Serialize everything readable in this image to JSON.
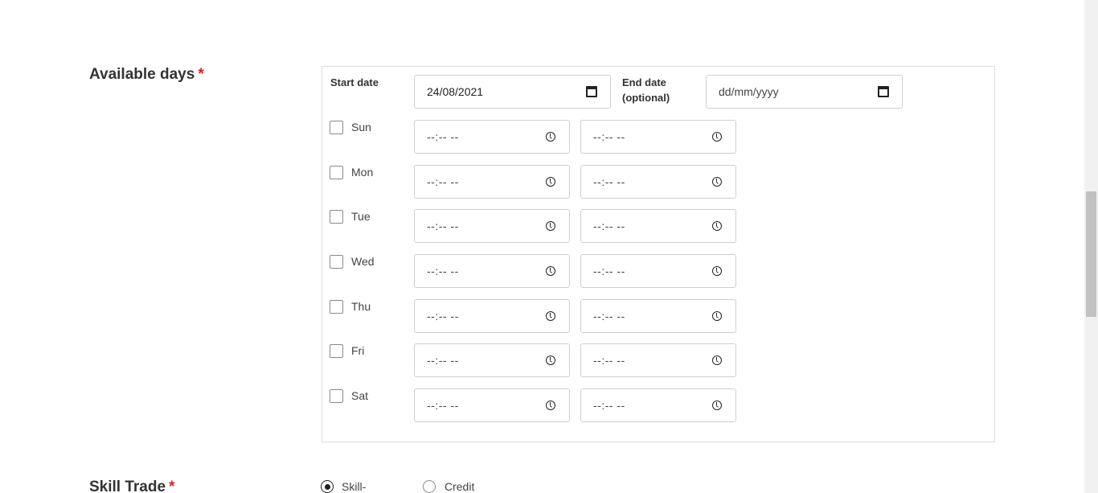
{
  "faded_text": "",
  "available_days": {
    "title": "Available days",
    "required_mark": "*",
    "start_date": {
      "label": "Start date",
      "value": "24/08/2021"
    },
    "end_date": {
      "label_line1": "End date",
      "label_line2": "(optional)",
      "placeholder": "dd/mm/yyyy"
    },
    "time_placeholder": "--:-- --",
    "days": [
      "Sun",
      "Mon",
      "Tue",
      "Wed",
      "Thu",
      "Fri",
      "Sat"
    ]
  },
  "skill_trade": {
    "title": "Skill Trade",
    "required_mark": "*",
    "options": [
      {
        "label": "Skill-exchange",
        "selected": true
      },
      {
        "label": "Credit",
        "selected": false
      }
    ]
  },
  "icons": {
    "date": "calendar-icon",
    "time": "clock-icon"
  },
  "colors": {
    "required": "#e02020",
    "border": "#cfcfcf"
  }
}
